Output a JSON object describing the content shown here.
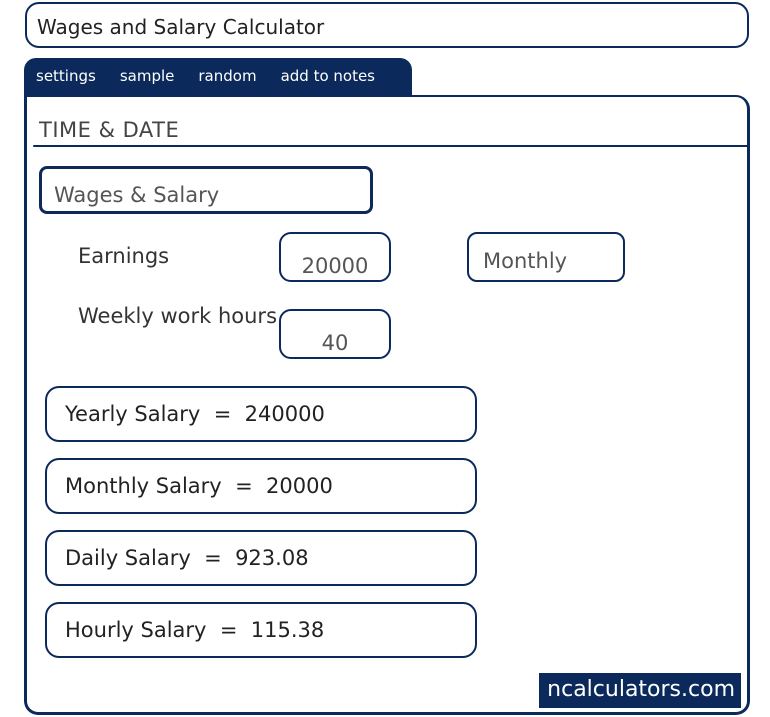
{
  "header": {
    "title": "Wages and Salary Calculator"
  },
  "tabs": [
    {
      "label": "settings"
    },
    {
      "label": "sample"
    },
    {
      "label": "random"
    },
    {
      "label": "add to notes"
    }
  ],
  "section": {
    "title": "TIME & DATE"
  },
  "calculator_select": {
    "value": "Wages & Salary"
  },
  "inputs": {
    "earnings": {
      "label": "Earnings",
      "value": "20000"
    },
    "period": {
      "value": "Monthly"
    },
    "weekly_hours": {
      "label": "Weekly work hours",
      "value": "40"
    }
  },
  "results": [
    {
      "label": "Yearly Salary",
      "value": "240000",
      "text": "Yearly Salary  =  240000"
    },
    {
      "label": "Monthly Salary",
      "value": "20000",
      "text": "Monthly Salary  =  20000"
    },
    {
      "label": "Daily Salary",
      "value": "923.08",
      "text": "Daily Salary  =  923.08"
    },
    {
      "label": "Hourly Salary",
      "value": "115.38",
      "text": "Hourly Salary  =  115.38"
    }
  ],
  "brand": {
    "text": "ncalculators.com"
  },
  "colors": {
    "accent": "#0b2a5b",
    "background": "#ffffff"
  }
}
